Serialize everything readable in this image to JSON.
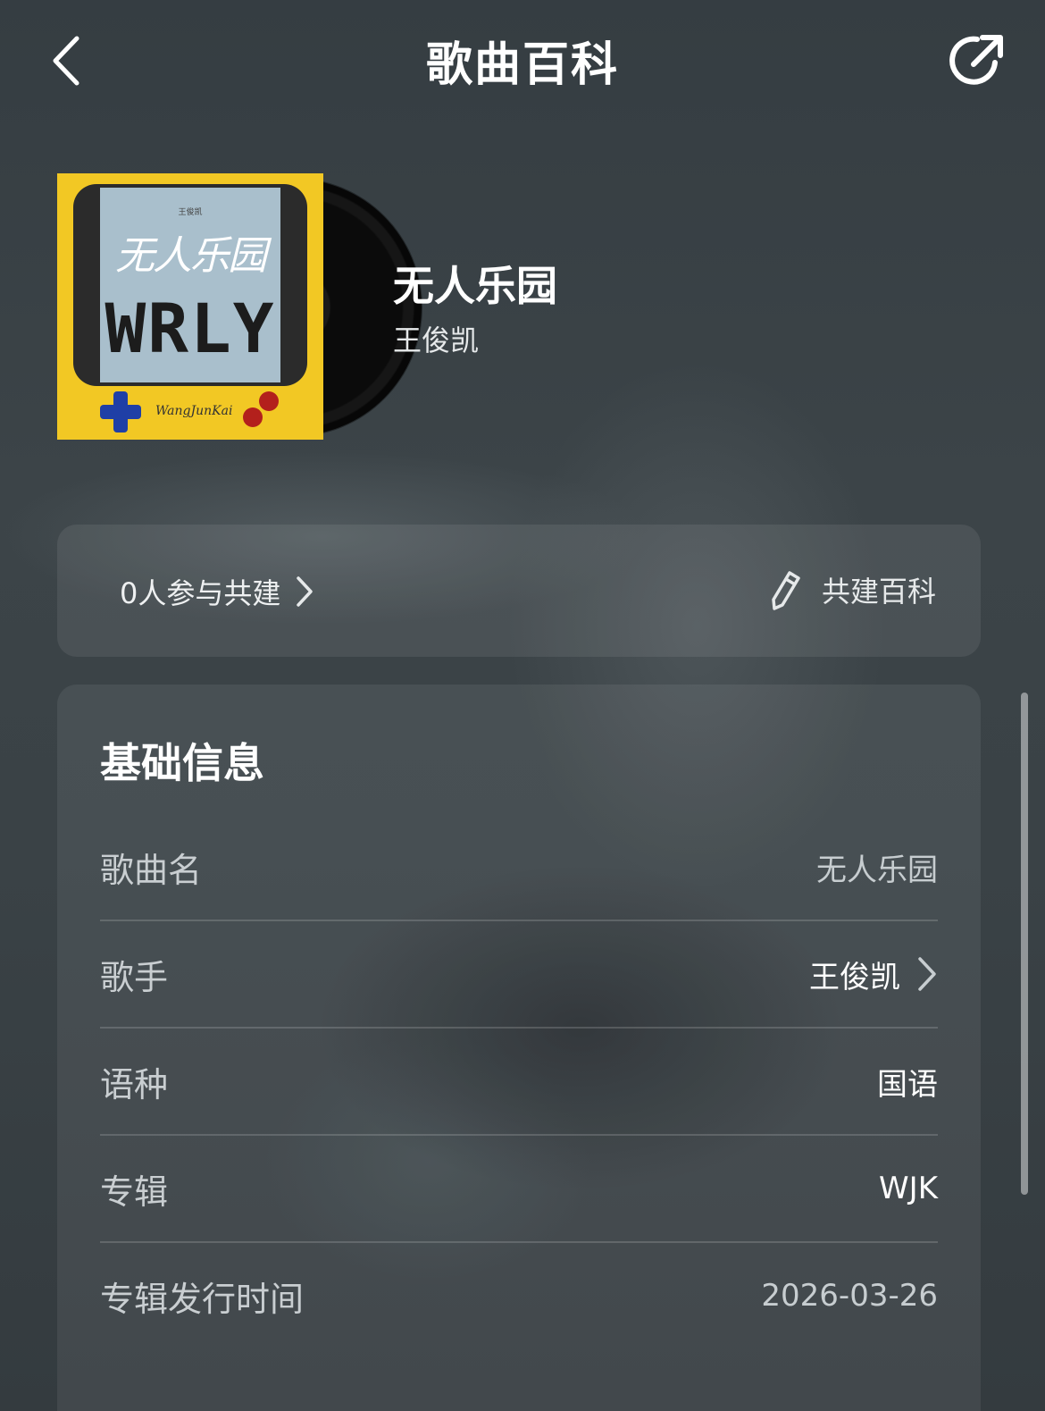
{
  "header": {
    "title": "歌曲百科",
    "back_icon": "chevron-left-icon",
    "share_icon": "share-icon"
  },
  "song": {
    "title": "无人乐园",
    "artist": "王俊凯",
    "cover": {
      "script_text": "无人乐园",
      "pixel_text": "WRLY",
      "signature": "WangJunKai",
      "background_color": "#f2c824",
      "screen_color": "#a9bfcc"
    }
  },
  "contribute": {
    "participants_label": "0人参与共建",
    "edit_label": "共建百科",
    "edit_icon": "pencil-icon",
    "arrow_icon": "chevron-right-icon"
  },
  "basic_info": {
    "heading": "基础信息",
    "rows": [
      {
        "label": "歌曲名",
        "value": "无人乐园"
      },
      {
        "label": "歌手",
        "value": "王俊凯"
      },
      {
        "label": "语种",
        "value": "国语"
      },
      {
        "label": "专辑",
        "value": "WJK"
      },
      {
        "label": "专辑发行时间",
        "value": "2026-03-26"
      }
    ]
  },
  "colors": {
    "background": "#3a4246",
    "text_primary": "#ffffff",
    "text_secondary": "#c9ced1"
  }
}
